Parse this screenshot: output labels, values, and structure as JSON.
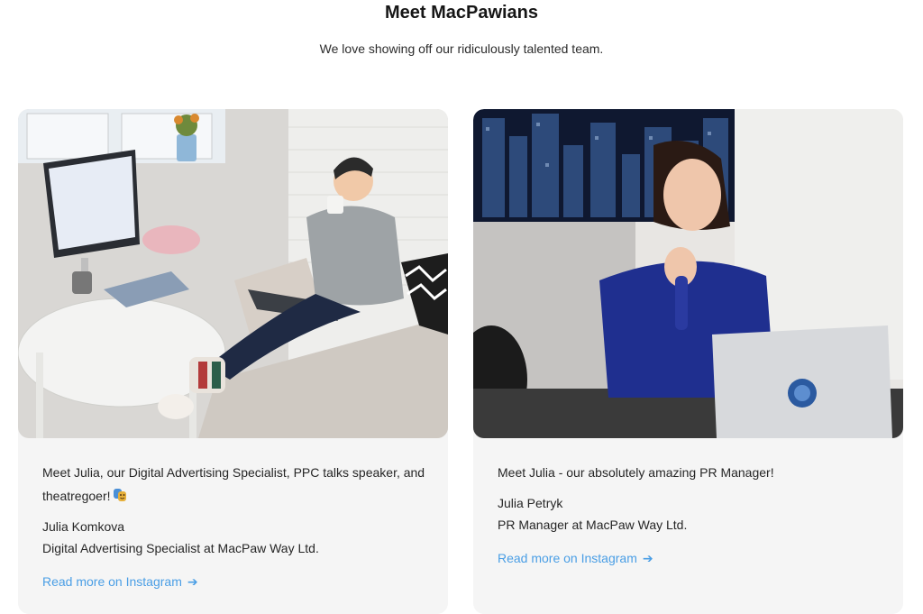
{
  "header": {
    "title": "Meet MacPawians",
    "subtitle": "We love showing off our ridiculously talented team."
  },
  "cards": [
    {
      "description": "Meet Julia, our Digital Advertising Specialist, PPC talks speaker, and theatregoer!",
      "emoji_icon": "theater-masks-icon",
      "name": "Julia Komkova",
      "role": "Digital Advertising Specialist at MacPaw Way Ltd.",
      "link_label": "Read more on Instagram",
      "arrow": "➔"
    },
    {
      "description": "Meet Julia - our absolutely amazing PR Manager!",
      "name": "Julia Petryk",
      "role": "PR Manager at MacPaw Way Ltd.",
      "link_label": "Read more on Instagram",
      "arrow": "➔"
    }
  ],
  "colors": {
    "link": "#4a9ee5",
    "card_bg": "#f5f5f5",
    "title": "#161616"
  }
}
